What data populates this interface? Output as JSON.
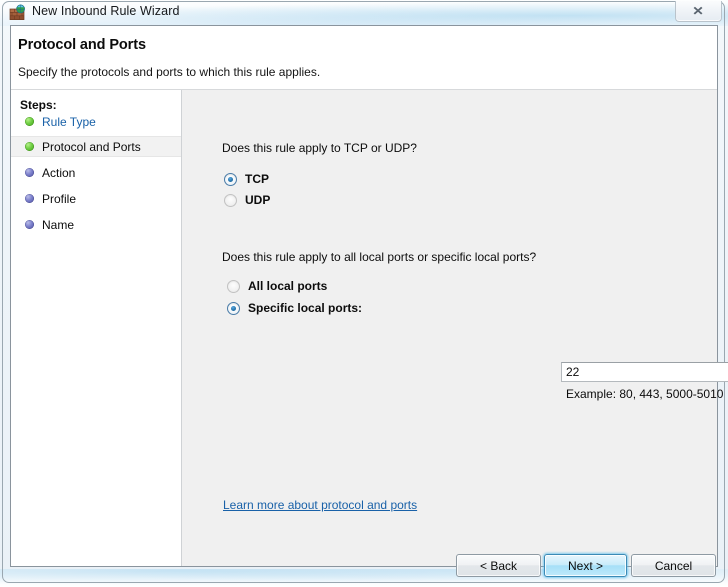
{
  "window": {
    "title": "New Inbound Rule Wizard",
    "icon": "firewall-globe-icon",
    "close_label": "✕"
  },
  "header": {
    "title": "Protocol and Ports",
    "subtitle": "Specify the protocols and ports to which this rule applies."
  },
  "sidebar": {
    "label": "Steps:",
    "items": [
      {
        "label": "Rule Type",
        "state": "completed",
        "bullet": "green",
        "is_link": true,
        "current": false
      },
      {
        "label": "Protocol and Ports",
        "state": "current",
        "bullet": "green",
        "is_link": false,
        "current": true
      },
      {
        "label": "Action",
        "state": "pending",
        "bullet": "blue",
        "is_link": false,
        "current": false
      },
      {
        "label": "Profile",
        "state": "pending",
        "bullet": "blue",
        "is_link": false,
        "current": false
      },
      {
        "label": "Name",
        "state": "pending",
        "bullet": "blue",
        "is_link": false,
        "current": false
      }
    ]
  },
  "main": {
    "protocol_question": "Does this rule apply to TCP or UDP?",
    "protocol_options": [
      {
        "label": "TCP",
        "selected": true
      },
      {
        "label": "UDP",
        "selected": false
      }
    ],
    "ports_question": "Does this rule apply to all local ports or specific local ports?",
    "ports_options": [
      {
        "label": "All local ports",
        "selected": false
      },
      {
        "label": "Specific local ports:",
        "selected": true
      }
    ],
    "ports_value": "22",
    "ports_placeholder": "",
    "example_text": "Example: 80, 443, 5000-5010",
    "learn_more": "Learn more about protocol and ports"
  },
  "footer": {
    "back_label": "< Back",
    "next_label": "Next >",
    "cancel_label": "Cancel"
  },
  "colors": {
    "link": "#1961a8",
    "bullet_done": "#3d9e16",
    "bullet_pending": "#4a4d9c",
    "default_button": "#a5dff7",
    "content_bg": "#f0f0f0"
  }
}
